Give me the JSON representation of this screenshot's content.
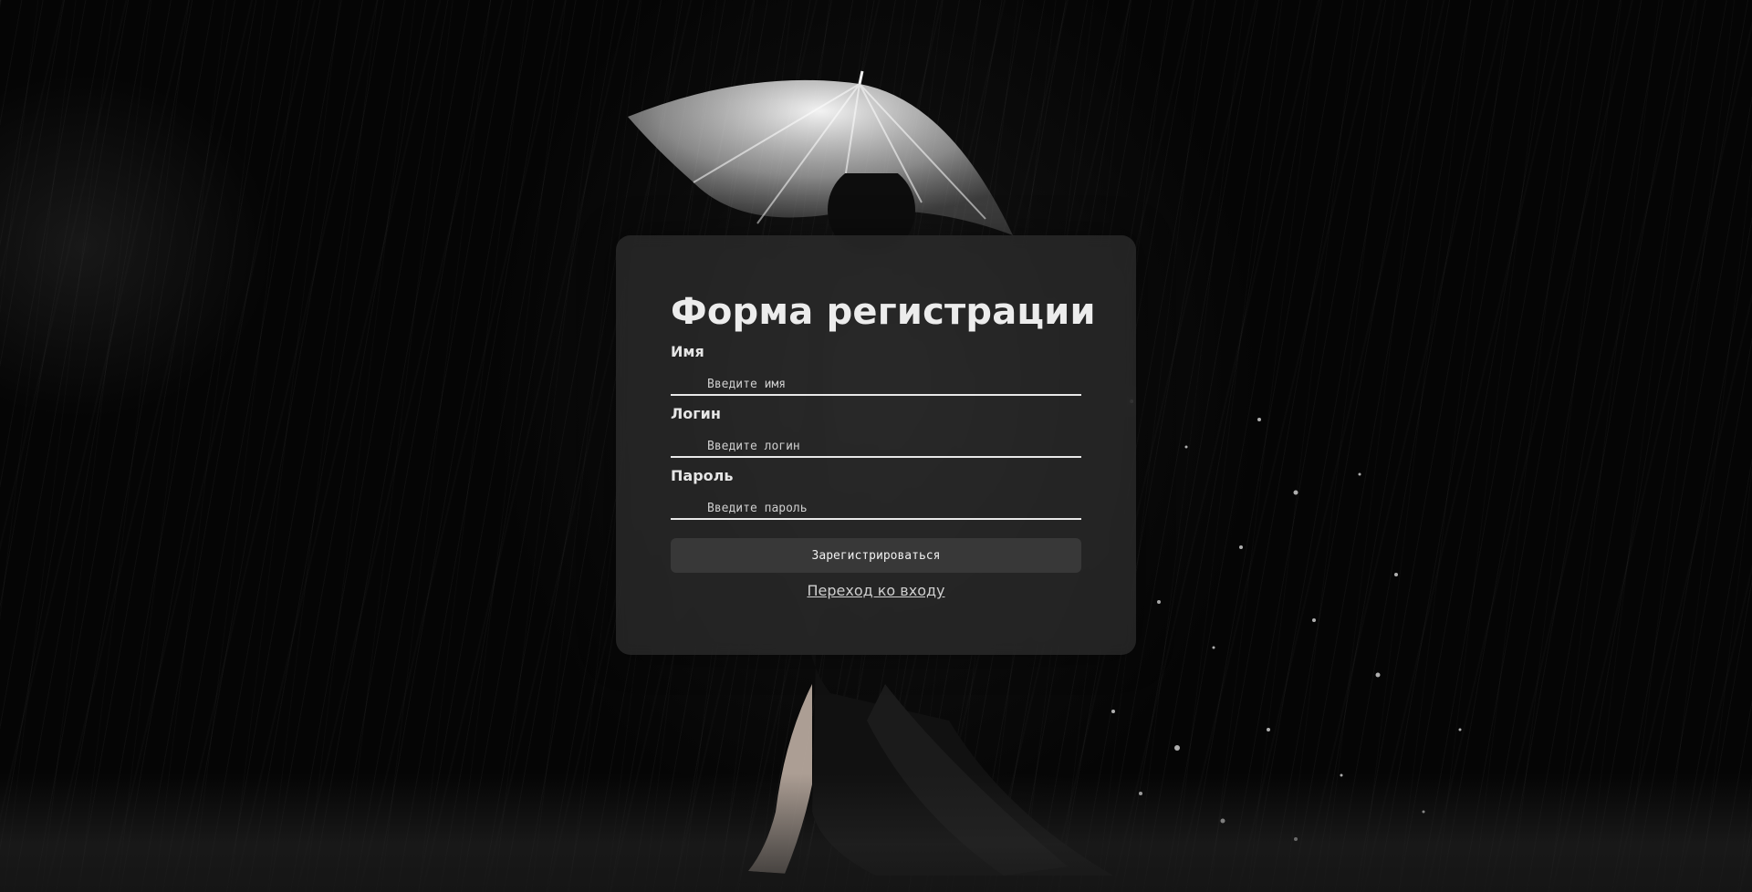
{
  "form": {
    "title": "Форма регистрации",
    "fields": [
      {
        "label": "Имя",
        "placeholder": "Введите имя",
        "value": ""
      },
      {
        "label": "Логин",
        "placeholder": "Введите логин",
        "value": ""
      },
      {
        "label": "Пароль",
        "placeholder": "Введите пароль",
        "value": ""
      }
    ],
    "submit_label": "Зарегистрироваться",
    "login_link_label": "Переход ко входу"
  },
  "background": {
    "scene": "woman-with-umbrella-in-rain",
    "icons": [
      "umbrella-icon"
    ]
  },
  "colors": {
    "card": "#2e2e2e",
    "text": "#ececec",
    "underline": "#e8e8e8",
    "button": "#3c3c3c"
  }
}
